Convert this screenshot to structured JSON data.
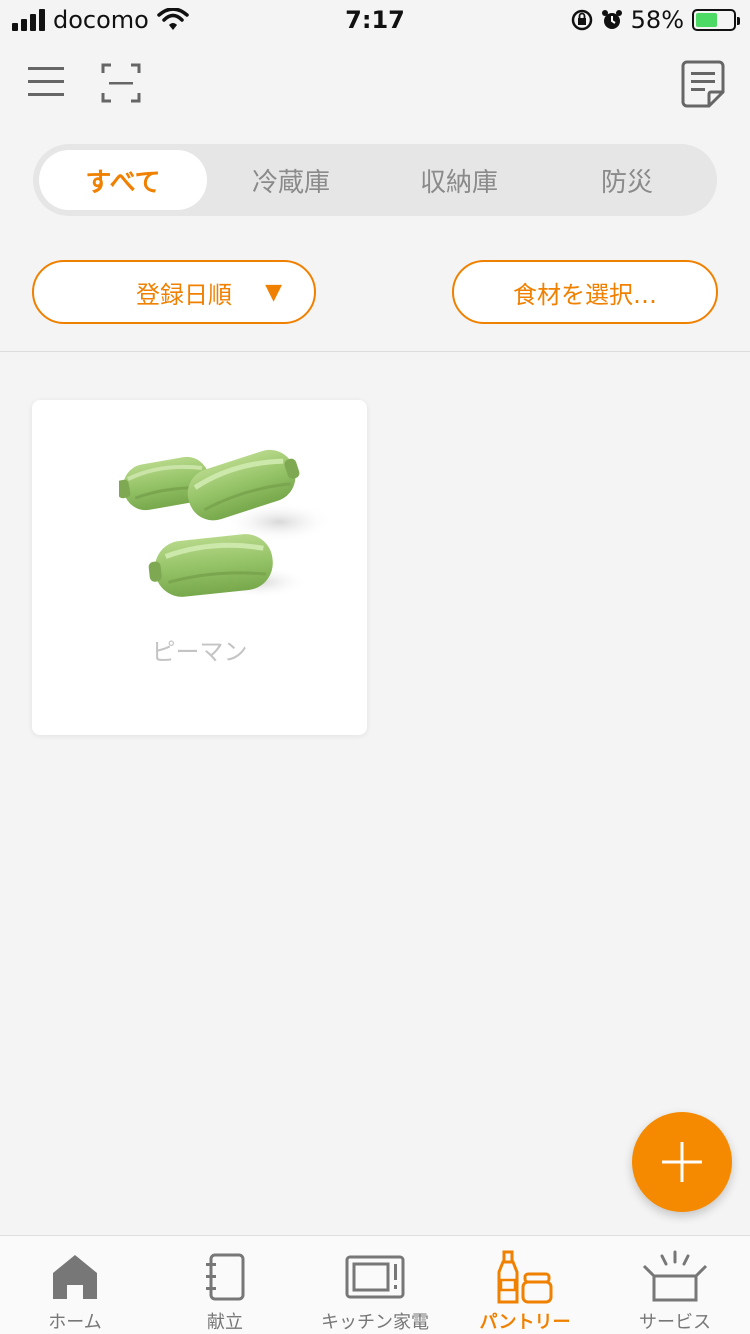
{
  "status_bar": {
    "carrier": "docomo",
    "time": "7:17",
    "battery_percent": "58%",
    "battery_level": 0.58,
    "icons": [
      "signal-icon",
      "wifi-icon",
      "rotation-lock-icon",
      "alarm-icon",
      "battery-charging-icon"
    ]
  },
  "toolbar": {
    "icons": [
      "menu-icon",
      "scan-icon",
      "memo-icon"
    ]
  },
  "segments": [
    {
      "label": "すべて",
      "active": true
    },
    {
      "label": "冷蔵庫",
      "active": false
    },
    {
      "label": "収納庫",
      "active": false
    },
    {
      "label": "防災",
      "active": false
    }
  ],
  "filters": {
    "sort_label": "登録日順",
    "sort_arrow": "▼",
    "ingredient_select": "食材を選択…"
  },
  "items": [
    {
      "name": "ピーマン",
      "image": "green-pepper-photo"
    }
  ],
  "fab": {
    "icon": "plus-icon"
  },
  "bottom_nav": [
    {
      "label": "ホーム",
      "icon": "home-icon",
      "active": false
    },
    {
      "label": "献立",
      "icon": "notebook-icon",
      "active": false
    },
    {
      "label": "キッチン家電",
      "icon": "microwave-icon",
      "active": false
    },
    {
      "label": "パントリー",
      "icon": "pantry-bottles-icon",
      "active": true
    },
    {
      "label": "サービス",
      "icon": "open-box-icon",
      "active": false
    }
  ],
  "colors": {
    "accent": "#f08000",
    "background": "#f4f4f4",
    "inactive": "#777777"
  }
}
